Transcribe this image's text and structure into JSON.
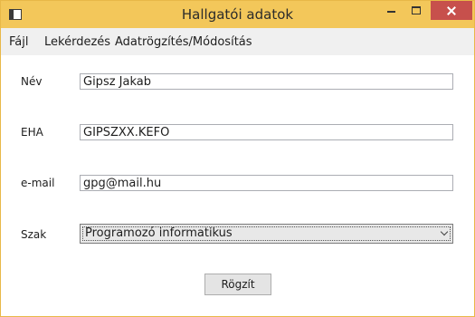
{
  "window": {
    "title": "Hallgatói adatok"
  },
  "menu": {
    "items": [
      {
        "label": "Fájl"
      },
      {
        "label": "Lekérdezés"
      },
      {
        "label": "Adatrögzítés/Módosítás"
      }
    ]
  },
  "form": {
    "name_label": "Név",
    "name_value": "Gipsz Jakab",
    "eha_label": "EHA",
    "eha_value": "GIPSZXX.KEFO",
    "email_label": "e-mail",
    "email_value": "gpg@mail.hu",
    "szak_label": "Szak",
    "szak_value": "Programozó informatikus",
    "save_label": "Rögzít"
  },
  "colors": {
    "titlebar": "#f3c75a",
    "close": "#c7504c"
  }
}
